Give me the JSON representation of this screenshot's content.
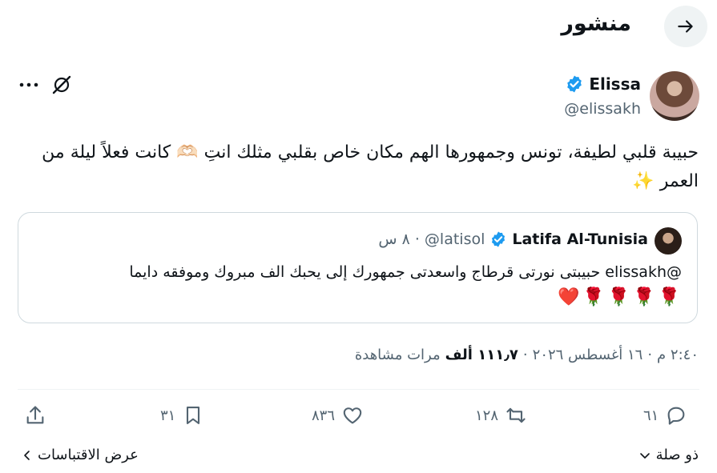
{
  "header": {
    "title": "منشور",
    "back_icon": "arrow-right-icon"
  },
  "author": {
    "name": "Elissa",
    "handle": "@elissakh",
    "verified_color": "#1d9bf0"
  },
  "tweet": {
    "text": "حبيبة قلبي لطيفة، تونس وجمهورها الهم مكان خاص بقلبي مثلك انتِ 🫶🏻 كانت فعلاً ليلة من العمر ✨"
  },
  "quote": {
    "name": "Latifa Al-Tunisia",
    "handle": "@latisol",
    "time": "٨ س",
    "text": "@elissakh حبيبتى نورتى قرطاج واسعدتى جمهورك إلى يحبك الف مبروك وموفقه دايما",
    "roses": [
      "🌹",
      "🌹",
      "🌹",
      "🌹",
      "❤️"
    ]
  },
  "meta": {
    "time": "٢:٤٠ م",
    "date": "١٦ أغسطس ٢٠٢٦",
    "views_count": "١١١٫٧ ألف",
    "views_label": "مرات مشاهدة"
  },
  "actions": {
    "reply_count": "٦١",
    "repost_count": "١٢٨",
    "like_count": "٨٣٦",
    "bookmark_count": "٣١"
  },
  "footer": {
    "relevant_label": "ذو صلة",
    "quotes_label": "عرض الاقتباسات"
  },
  "colors": {
    "text": "#0f1419",
    "muted": "#536471",
    "accent": "#1d9bf0",
    "border": "#cfd9de"
  }
}
